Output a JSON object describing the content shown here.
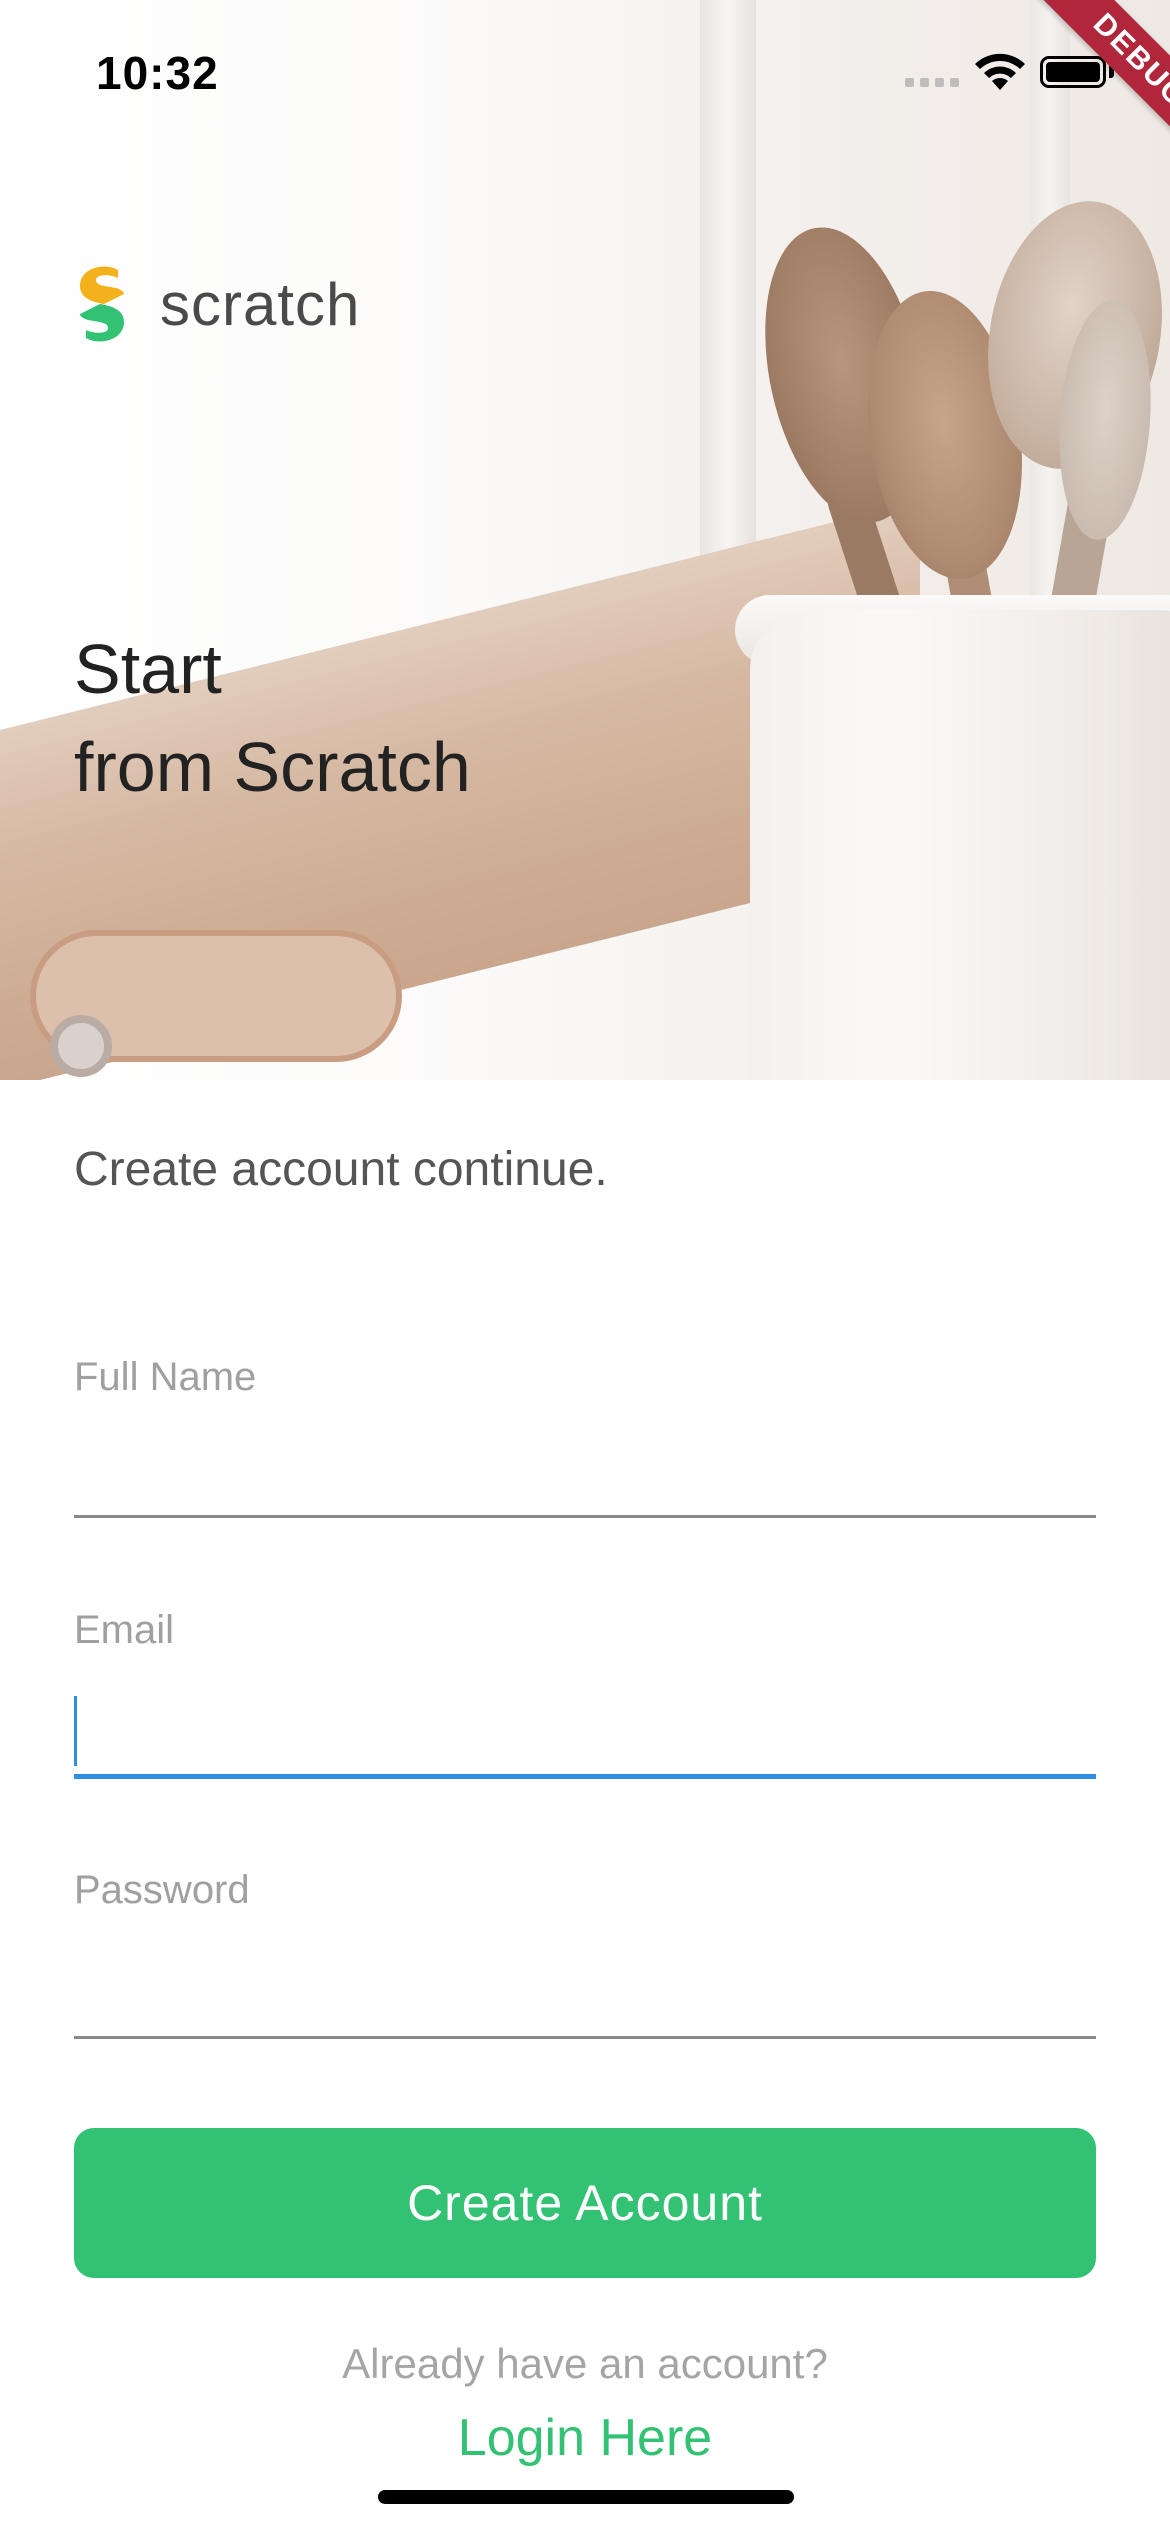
{
  "status_bar": {
    "time": "10:32",
    "debug_label": "DEBUG"
  },
  "brand": {
    "name": "scratch",
    "colors": {
      "logo_top": "#f3b21c",
      "logo_bottom": "#33c173"
    }
  },
  "hero": {
    "title_line1": "Start",
    "title_line2": "from Scratch"
  },
  "form": {
    "subtitle": "Create account continue.",
    "fields": [
      {
        "label": "Full Name",
        "value": "",
        "active": false
      },
      {
        "label": "Email",
        "value": "",
        "active": true
      },
      {
        "label": "Password",
        "value": "",
        "active": false
      }
    ],
    "submit_label": "Create Account",
    "accent_color": "#33c173",
    "focus_color": "#2f8fe4"
  },
  "footer": {
    "prompt": "Already have an account?",
    "login_label": "Login Here"
  },
  "icons": [
    "signal-icon",
    "wifi-icon",
    "battery-icon",
    "scratch-logo-icon"
  ]
}
